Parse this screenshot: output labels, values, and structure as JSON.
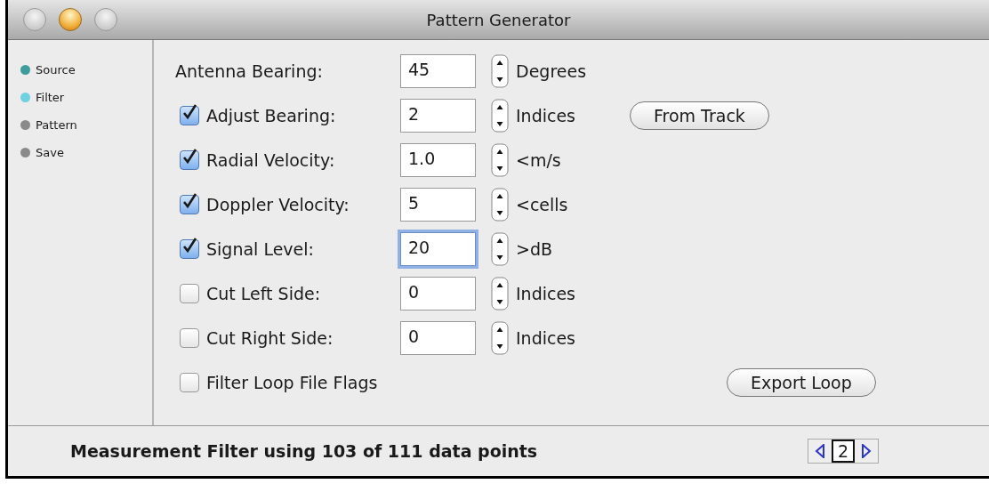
{
  "window": {
    "title": "Pattern Generator"
  },
  "steps": [
    {
      "label": "Source",
      "color": "#3e9c9c"
    },
    {
      "label": "Filter",
      "color": "#6fd0e0"
    },
    {
      "label": "Pattern",
      "color": "#8a8a8a"
    },
    {
      "label": "Save",
      "color": "#8a8a8a"
    }
  ],
  "rows": [
    {
      "kind": "field",
      "label": "Antenna Bearing:",
      "value": "45",
      "unit": "Degrees",
      "focused": false
    },
    {
      "kind": "check_field",
      "label": "Adjust Bearing:",
      "checked": true,
      "value": "2",
      "unit": "Indices",
      "focused": false,
      "button": "From Track"
    },
    {
      "kind": "check_field",
      "label": "Radial Velocity:",
      "checked": true,
      "value": "1.0",
      "unit": "<m/s",
      "focused": false
    },
    {
      "kind": "check_field",
      "label": "Doppler Velocity:",
      "checked": true,
      "value": "5",
      "unit": "<cells",
      "focused": false
    },
    {
      "kind": "check_field",
      "label": "Signal Level:",
      "checked": true,
      "value": "20",
      "unit": ">dB",
      "focused": true
    },
    {
      "kind": "check_field",
      "label": "Cut Left Side:",
      "checked": false,
      "value": "0",
      "unit": "Indices",
      "focused": false
    },
    {
      "kind": "check_field",
      "label": "Cut Right Side:",
      "checked": false,
      "value": "0",
      "unit": "Indices",
      "focused": false
    },
    {
      "kind": "check",
      "label": "Filter Loop File Flags",
      "checked": false,
      "button": "Export Loop"
    }
  ],
  "status_bar": {
    "message": "Measurement Filter using 103 of 111 data points",
    "page": "2"
  }
}
